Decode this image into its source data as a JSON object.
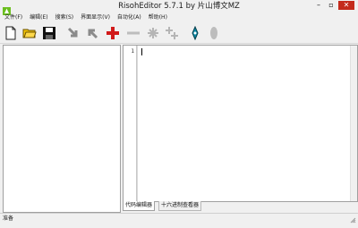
{
  "window": {
    "title": "RisohEditor 5.7.1 by 片山博文MZ",
    "controls": {
      "minimize": "–",
      "maximize": "▫",
      "close": "✕"
    }
  },
  "menu": [
    {
      "label": "文件(F)"
    },
    {
      "label": "编辑(E)"
    },
    {
      "label": "搜索(S)"
    },
    {
      "label": "界面显示(V)"
    },
    {
      "label": "自动化(A)"
    },
    {
      "label": "帮助(H)"
    }
  ],
  "toolbar": {
    "icons": [
      "new-file-icon",
      "open-folder-icon",
      "save-icon",
      "import-arrow-icon",
      "export-arrow-icon",
      "add-icon",
      "remove-icon",
      "star-icon",
      "plus-plus-icon",
      "compile-pen-icon",
      "ellipse-icon"
    ],
    "colors": {
      "add": "#d11a1a",
      "teal": "#0a8aa6",
      "folder": "#e0b000"
    }
  },
  "editor": {
    "line_numbers": [
      "1"
    ],
    "content": ""
  },
  "tabs": [
    {
      "label": "代码编辑器",
      "active": true
    },
    {
      "label": "十六进制查看器",
      "active": false
    }
  ],
  "status": {
    "text": "准备"
  }
}
